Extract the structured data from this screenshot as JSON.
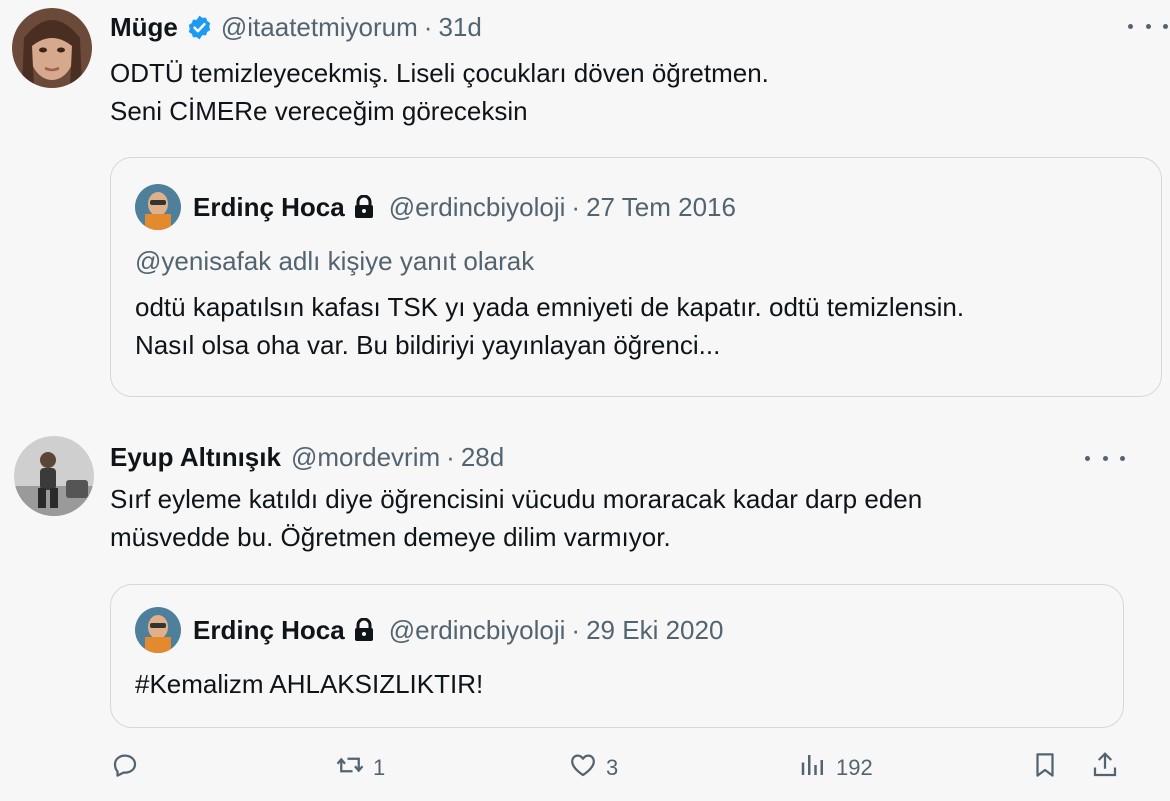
{
  "tweet1": {
    "name": "Müge",
    "handle": "@itaatetmiyorum",
    "time": "31d",
    "line1": "ODTÜ temizleyecekmiş. Liseli çocukları döven öğretmen.",
    "line2": "Seni CİMERe vereceğim göreceksin",
    "quote": {
      "name": "Erdinç Hoca",
      "handle": "@erdincbiyoloji",
      "date": "27 Tem 2016",
      "reply_to": "@yenisafak adlı kişiye yanıt olarak",
      "line1": "odtü kapatılsın kafası TSK yı yada emniyeti de kapatır. odtü temizlensin.",
      "line2": "Nasıl olsa oha var. Bu bildiriyi yayınlayan öğrenci..."
    }
  },
  "tweet2": {
    "name": "Eyup Altınışık",
    "handle": "@mordevrim",
    "time": "28d",
    "line1": "Sırf eyleme katıldı diye öğrencisini vücudu moraracak kadar darp eden",
    "line2": "müsvedde bu. Öğretmen demeye dilim varmıyor.",
    "quote": {
      "name": "Erdinç Hoca",
      "handle": "@erdincbiyoloji",
      "date": "29 Eki 2020",
      "text": "#Kemalizm AHLAKSIZLIKTIR!"
    }
  },
  "separator": "·",
  "actions": {
    "reply_icon": "reply-icon",
    "retweet_count": "1",
    "like_count": "3",
    "views_count": "192",
    "bookmark_icon": "bookmark-icon",
    "share_icon": "share-icon"
  },
  "colors": {
    "text": "#0f1419",
    "muted": "#536471",
    "verified": "#1d9bf0",
    "border": "#cfd9de",
    "background": "#f7f7f7"
  }
}
